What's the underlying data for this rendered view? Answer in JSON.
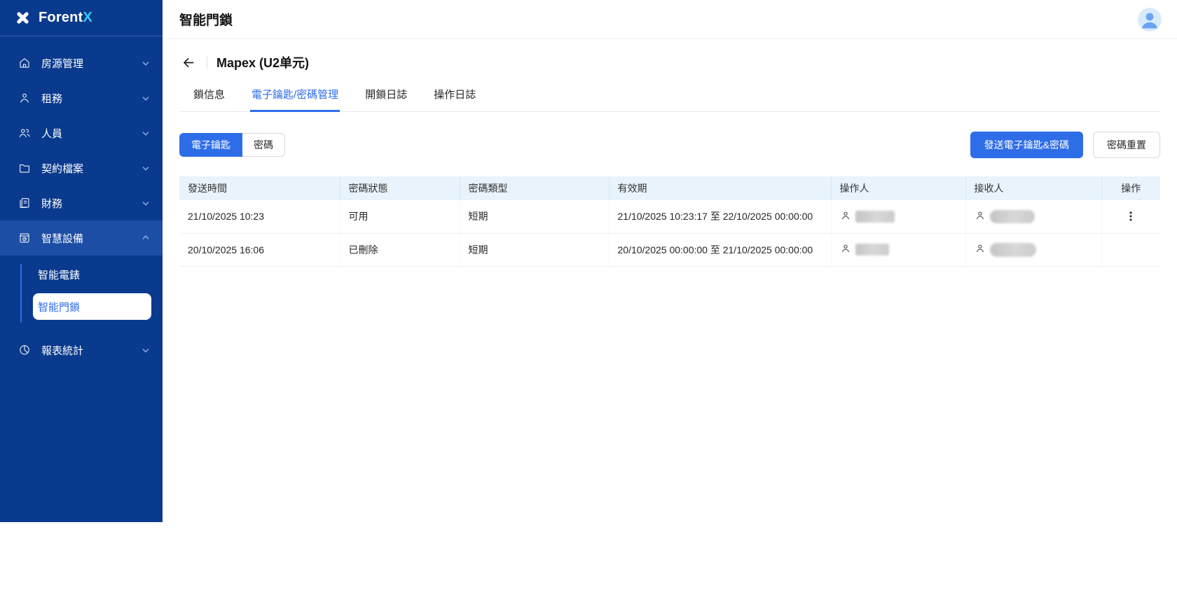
{
  "app": {
    "logo_text": "Forent",
    "logo_accent": "X"
  },
  "colors": {
    "accent": "#2e6de8",
    "sidebar_bg": "#0a3a8e",
    "sidebar_active_bg": "#1d4ea6",
    "logo_accent_color": "#3cc8f2",
    "table_header_bg": "#e8f3fc"
  },
  "sidebar": {
    "items": [
      {
        "label": "房源管理",
        "icon": "home-icon",
        "chevron": "down"
      },
      {
        "label": "租務",
        "icon": "user-icon",
        "chevron": "down"
      },
      {
        "label": "人員",
        "icon": "users-icon",
        "chevron": "down"
      },
      {
        "label": "契約檔案",
        "icon": "folder-icon",
        "chevron": "down"
      },
      {
        "label": "財務",
        "icon": "finance-doc-icon",
        "chevron": "down"
      },
      {
        "label": "智慧設備",
        "icon": "smart-device-icon",
        "chevron": "up",
        "active": true
      },
      {
        "label": "報表統計",
        "icon": "pie-chart-icon",
        "chevron": "down"
      }
    ],
    "subitems": [
      {
        "label": "智能電錶",
        "selected": false
      },
      {
        "label": "智能門鎖",
        "selected": true
      }
    ]
  },
  "header": {
    "title": "智能門鎖"
  },
  "page": {
    "back_title": "Mapex (U2单元)",
    "tabs": [
      {
        "label": "鎖信息",
        "active": false
      },
      {
        "label": "電子鑰匙/密碼管理",
        "active": true
      },
      {
        "label": "開鎖日誌",
        "active": false
      },
      {
        "label": "操作日誌",
        "active": false
      }
    ],
    "segmented": [
      {
        "label": "電子鑰匙",
        "active": true
      },
      {
        "label": "密碼",
        "active": false
      }
    ],
    "actions": {
      "primary": "發送電子鑰匙&密碼",
      "secondary": "密碼重置"
    }
  },
  "table": {
    "columns": [
      "發送時間",
      "密碼狀態",
      "密碼類型",
      "有效期",
      "操作人",
      "接收人",
      "操作"
    ],
    "rows": [
      {
        "sent": "21/10/2025 10:23",
        "status": "可用",
        "type": "短期",
        "validity": "21/10/2025 10:23:17 至 22/10/2025 00:00:00",
        "operator": "[redacted]",
        "receiver": "[redacted]",
        "has_menu": true
      },
      {
        "sent": "20/10/2025 16:06",
        "status": "已刪除",
        "type": "短期",
        "validity": "20/10/2025 00:00:00 至 21/10/2025 00:00:00",
        "operator": "[redacted]",
        "receiver": "[redacted]",
        "has_menu": false
      }
    ]
  }
}
